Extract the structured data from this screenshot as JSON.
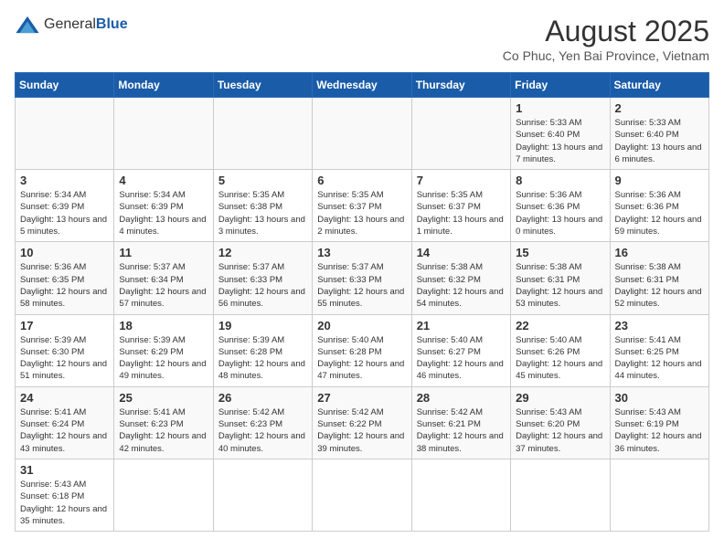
{
  "logo": {
    "general": "General",
    "blue": "Blue"
  },
  "title": "August 2025",
  "subtitle": "Co Phuc, Yen Bai Province, Vietnam",
  "weekdays": [
    "Sunday",
    "Monday",
    "Tuesday",
    "Wednesday",
    "Thursday",
    "Friday",
    "Saturday"
  ],
  "weeks": [
    [
      {
        "day": "",
        "info": ""
      },
      {
        "day": "",
        "info": ""
      },
      {
        "day": "",
        "info": ""
      },
      {
        "day": "",
        "info": ""
      },
      {
        "day": "",
        "info": ""
      },
      {
        "day": "1",
        "info": "Sunrise: 5:33 AM\nSunset: 6:40 PM\nDaylight: 13 hours and 7 minutes."
      },
      {
        "day": "2",
        "info": "Sunrise: 5:33 AM\nSunset: 6:40 PM\nDaylight: 13 hours and 6 minutes."
      }
    ],
    [
      {
        "day": "3",
        "info": "Sunrise: 5:34 AM\nSunset: 6:39 PM\nDaylight: 13 hours and 5 minutes."
      },
      {
        "day": "4",
        "info": "Sunrise: 5:34 AM\nSunset: 6:39 PM\nDaylight: 13 hours and 4 minutes."
      },
      {
        "day": "5",
        "info": "Sunrise: 5:35 AM\nSunset: 6:38 PM\nDaylight: 13 hours and 3 minutes."
      },
      {
        "day": "6",
        "info": "Sunrise: 5:35 AM\nSunset: 6:37 PM\nDaylight: 13 hours and 2 minutes."
      },
      {
        "day": "7",
        "info": "Sunrise: 5:35 AM\nSunset: 6:37 PM\nDaylight: 13 hours and 1 minute."
      },
      {
        "day": "8",
        "info": "Sunrise: 5:36 AM\nSunset: 6:36 PM\nDaylight: 13 hours and 0 minutes."
      },
      {
        "day": "9",
        "info": "Sunrise: 5:36 AM\nSunset: 6:36 PM\nDaylight: 12 hours and 59 minutes."
      }
    ],
    [
      {
        "day": "10",
        "info": "Sunrise: 5:36 AM\nSunset: 6:35 PM\nDaylight: 12 hours and 58 minutes."
      },
      {
        "day": "11",
        "info": "Sunrise: 5:37 AM\nSunset: 6:34 PM\nDaylight: 12 hours and 57 minutes."
      },
      {
        "day": "12",
        "info": "Sunrise: 5:37 AM\nSunset: 6:33 PM\nDaylight: 12 hours and 56 minutes."
      },
      {
        "day": "13",
        "info": "Sunrise: 5:37 AM\nSunset: 6:33 PM\nDaylight: 12 hours and 55 minutes."
      },
      {
        "day": "14",
        "info": "Sunrise: 5:38 AM\nSunset: 6:32 PM\nDaylight: 12 hours and 54 minutes."
      },
      {
        "day": "15",
        "info": "Sunrise: 5:38 AM\nSunset: 6:31 PM\nDaylight: 12 hours and 53 minutes."
      },
      {
        "day": "16",
        "info": "Sunrise: 5:38 AM\nSunset: 6:31 PM\nDaylight: 12 hours and 52 minutes."
      }
    ],
    [
      {
        "day": "17",
        "info": "Sunrise: 5:39 AM\nSunset: 6:30 PM\nDaylight: 12 hours and 51 minutes."
      },
      {
        "day": "18",
        "info": "Sunrise: 5:39 AM\nSunset: 6:29 PM\nDaylight: 12 hours and 49 minutes."
      },
      {
        "day": "19",
        "info": "Sunrise: 5:39 AM\nSunset: 6:28 PM\nDaylight: 12 hours and 48 minutes."
      },
      {
        "day": "20",
        "info": "Sunrise: 5:40 AM\nSunset: 6:28 PM\nDaylight: 12 hours and 47 minutes."
      },
      {
        "day": "21",
        "info": "Sunrise: 5:40 AM\nSunset: 6:27 PM\nDaylight: 12 hours and 46 minutes."
      },
      {
        "day": "22",
        "info": "Sunrise: 5:40 AM\nSunset: 6:26 PM\nDaylight: 12 hours and 45 minutes."
      },
      {
        "day": "23",
        "info": "Sunrise: 5:41 AM\nSunset: 6:25 PM\nDaylight: 12 hours and 44 minutes."
      }
    ],
    [
      {
        "day": "24",
        "info": "Sunrise: 5:41 AM\nSunset: 6:24 PM\nDaylight: 12 hours and 43 minutes."
      },
      {
        "day": "25",
        "info": "Sunrise: 5:41 AM\nSunset: 6:23 PM\nDaylight: 12 hours and 42 minutes."
      },
      {
        "day": "26",
        "info": "Sunrise: 5:42 AM\nSunset: 6:23 PM\nDaylight: 12 hours and 40 minutes."
      },
      {
        "day": "27",
        "info": "Sunrise: 5:42 AM\nSunset: 6:22 PM\nDaylight: 12 hours and 39 minutes."
      },
      {
        "day": "28",
        "info": "Sunrise: 5:42 AM\nSunset: 6:21 PM\nDaylight: 12 hours and 38 minutes."
      },
      {
        "day": "29",
        "info": "Sunrise: 5:43 AM\nSunset: 6:20 PM\nDaylight: 12 hours and 37 minutes."
      },
      {
        "day": "30",
        "info": "Sunrise: 5:43 AM\nSunset: 6:19 PM\nDaylight: 12 hours and 36 minutes."
      }
    ],
    [
      {
        "day": "31",
        "info": "Sunrise: 5:43 AM\nSunset: 6:18 PM\nDaylight: 12 hours and 35 minutes."
      },
      {
        "day": "",
        "info": ""
      },
      {
        "day": "",
        "info": ""
      },
      {
        "day": "",
        "info": ""
      },
      {
        "day": "",
        "info": ""
      },
      {
        "day": "",
        "info": ""
      },
      {
        "day": "",
        "info": ""
      }
    ]
  ]
}
